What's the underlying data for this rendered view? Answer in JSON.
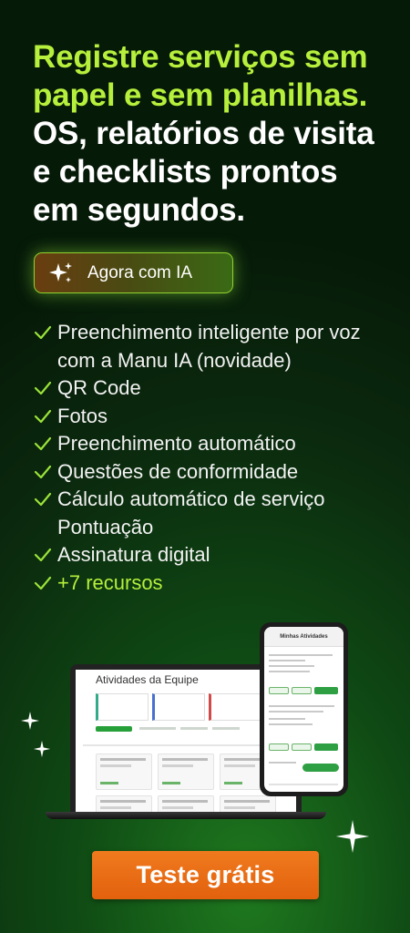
{
  "headline": {
    "line1": "Registre serviços sem",
    "line2": "papel e sem planilhas.",
    "line3": "OS, relatórios de visita",
    "line4": "e checklists prontos",
    "line5": "em segundos."
  },
  "ai_badge": {
    "label": "Agora com IA",
    "icon": "sparkle-icon"
  },
  "features": [
    "Preenchimento inteligente por voz com a Manu IA (novidade)",
    "QR Code",
    "Fotos",
    "Preenchimento automático",
    "Questões de conformidade",
    "Cálculo automático de serviço Pontuação",
    "Assinatura digital",
    "+7 recursos"
  ],
  "laptop_screen": {
    "title": "Atividades da Equipe"
  },
  "phone_screen": {
    "title": "Minhas Atividades"
  },
  "cta": {
    "label": "Teste grátis"
  },
  "colors": {
    "accent": "#b6f03c",
    "cta": "#e8690f",
    "bg": "#0b2a0e"
  }
}
